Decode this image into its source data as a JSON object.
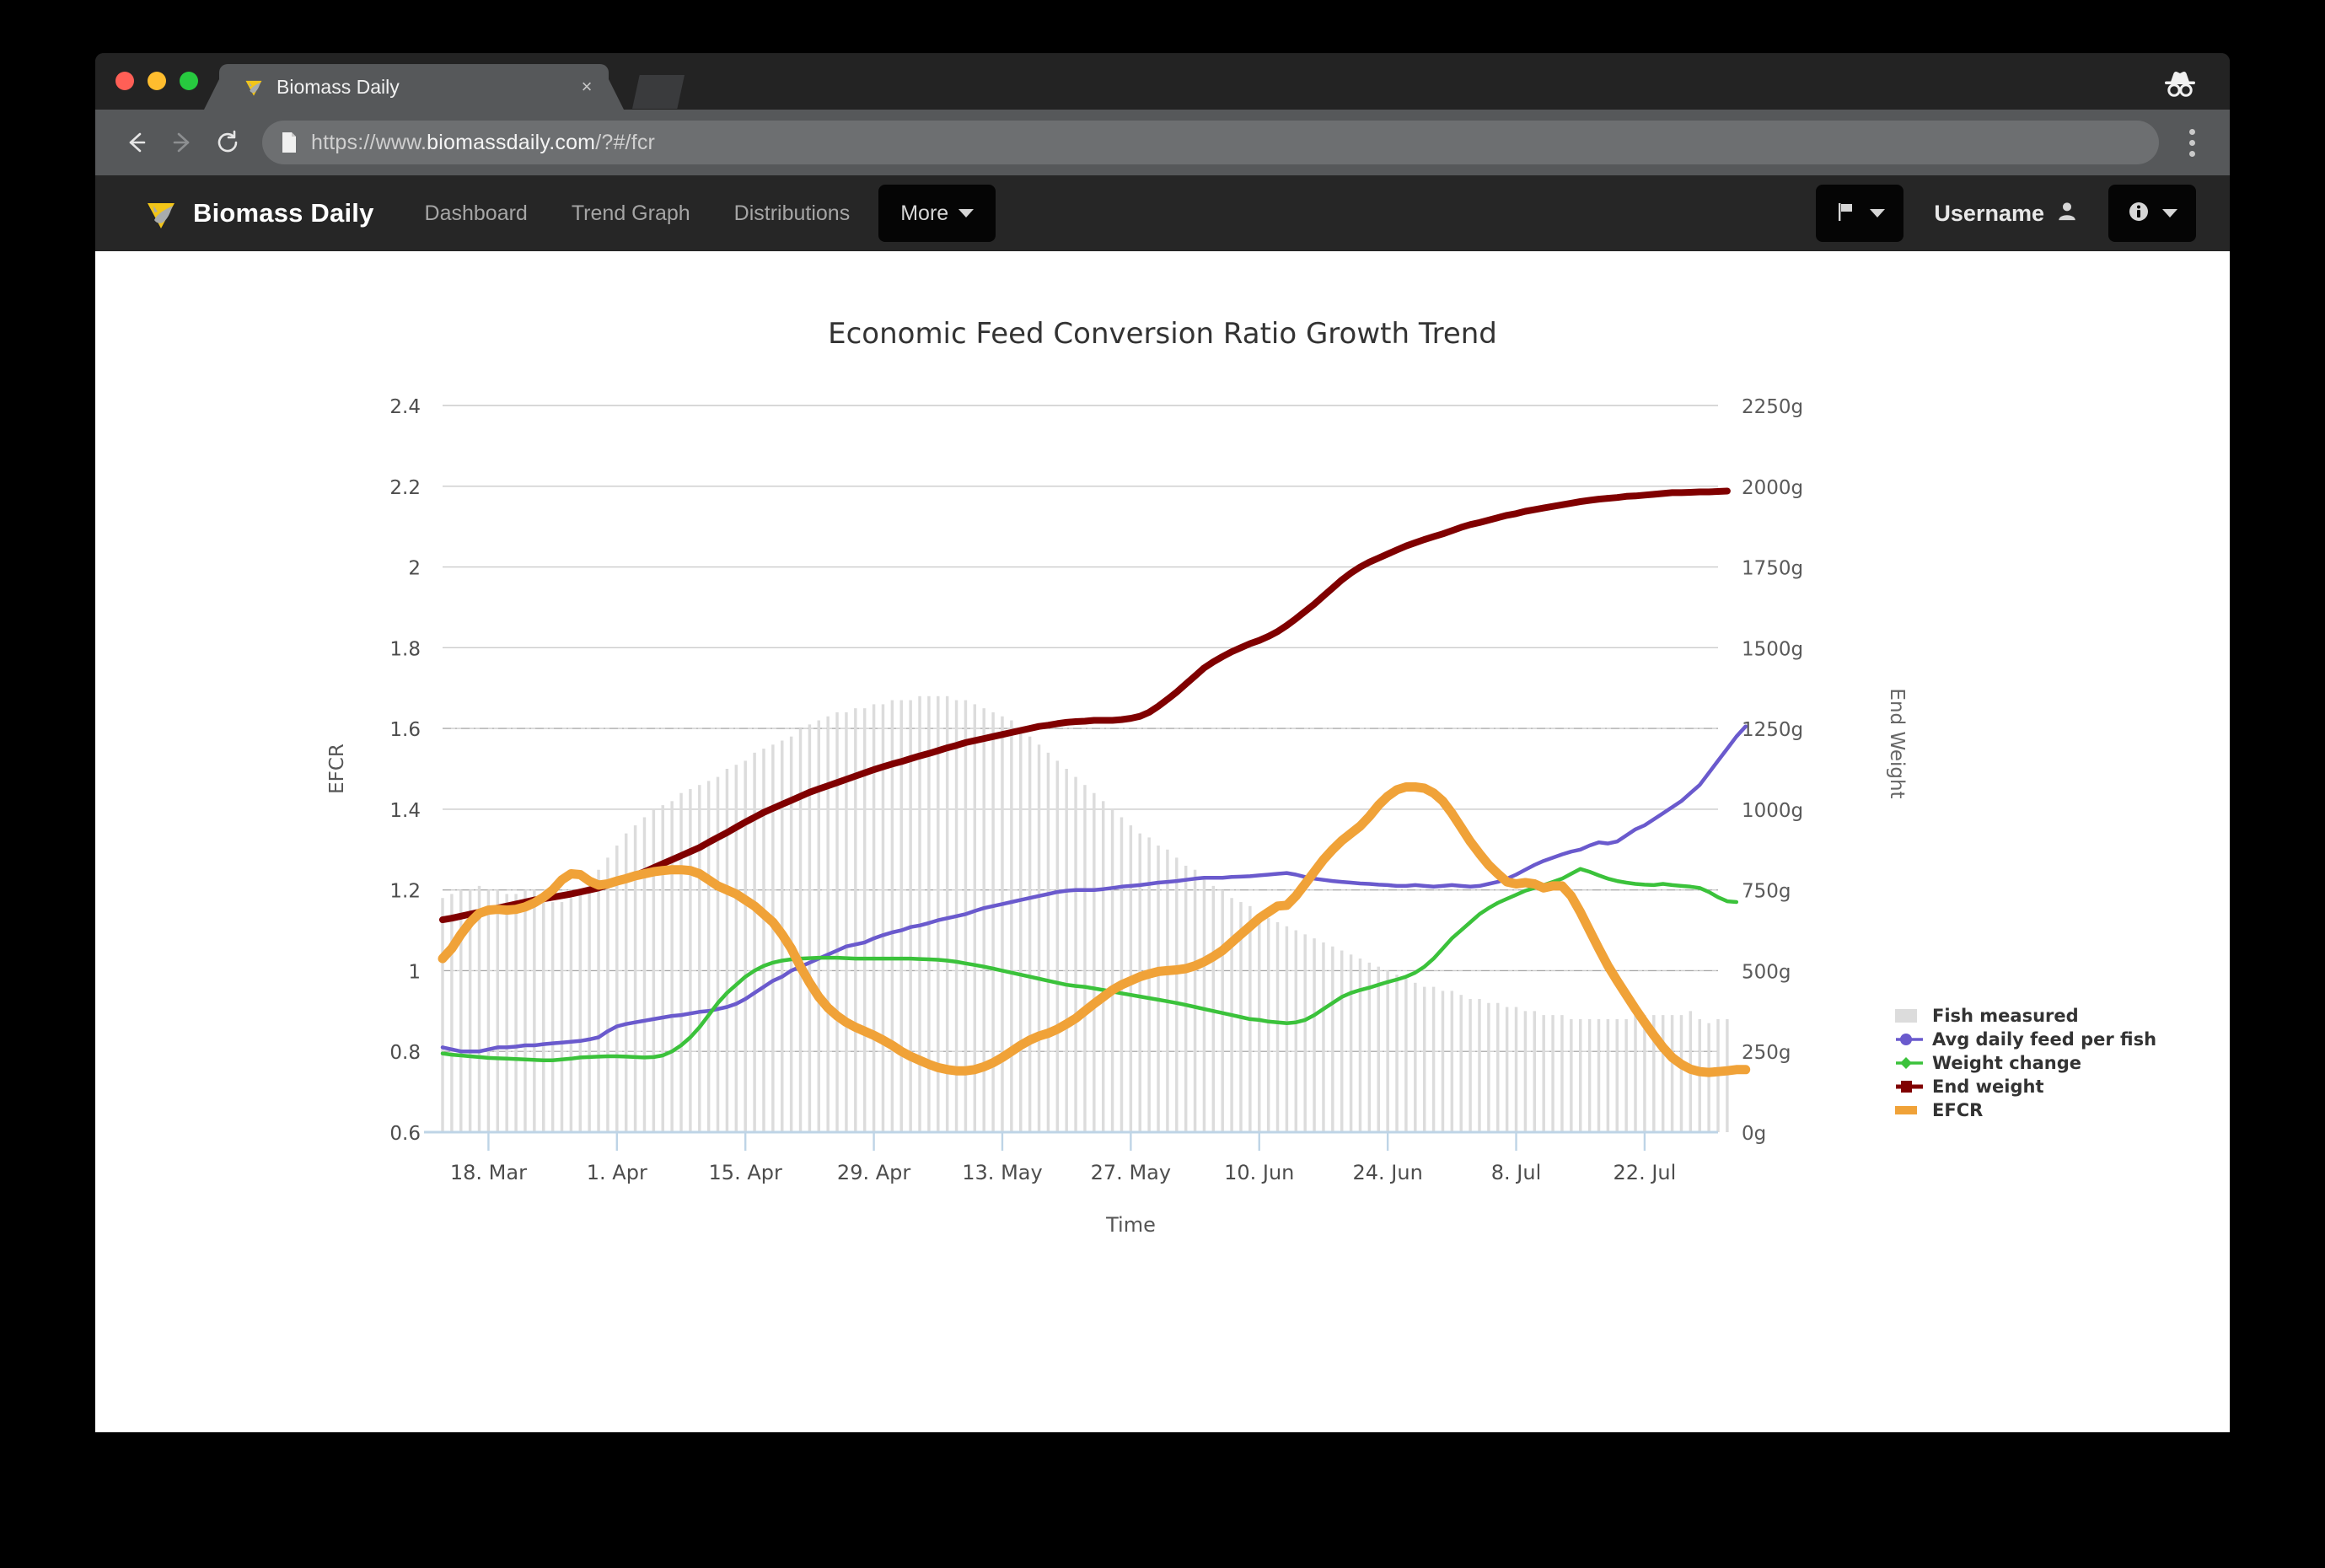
{
  "browser": {
    "tab": {
      "title": "Biomass Daily",
      "close_label": "×",
      "favicon": "fish-triangle-icon"
    },
    "new_tab_label": "new-tab",
    "incognito_label": "incognito-icon",
    "toolbar": {
      "back": "back-arrow-icon",
      "forward": "forward-arrow-icon",
      "reload": "reload-icon",
      "url_prefix": "https://www.",
      "url_host": "biomassdaily.com",
      "url_suffix": "/?#/fcr",
      "url_full": "https://www.biomassdaily.com/?#/fcr",
      "menu": "three-dots-icon"
    }
  },
  "navbar": {
    "brand": "Biomass Daily",
    "links": [
      {
        "label": "Dashboard"
      },
      {
        "label": "Trend Graph"
      },
      {
        "label": "Distributions"
      }
    ],
    "more_label": "More",
    "flag_icon": "flag-icon",
    "username": "Username",
    "user_icon": "person-icon",
    "info_icon": "info-circle-icon"
  },
  "colors": {
    "fish_measured": "#dcdcdc",
    "avg_daily_feed": "#6a5acd",
    "weight_change": "#3bc23b",
    "end_weight": "#800000",
    "efcr": "#f0a238",
    "axis": "#c5d8e8",
    "grid": "#cccccc",
    "navbar_bg": "#262626",
    "brand_yellow": "#f2c518"
  },
  "chart_data": {
    "type": "line",
    "title": "Economic Feed Conversion Ratio Growth Trend",
    "xlabel": "Time",
    "ylabel": "EFCR",
    "y2label": "End Weight",
    "grid": true,
    "legend_position": "right",
    "ylim": [
      0.6,
      2.4
    ],
    "yticks": [
      "0.6",
      "0.8",
      "1",
      "1.2",
      "1.4",
      "1.6",
      "1.8",
      "2",
      "2.2",
      "2.4"
    ],
    "y2lim": [
      0,
      2250
    ],
    "y2ticks": [
      "0g",
      "250g",
      "500g",
      "750g",
      "1000g",
      "1250g",
      "1500g",
      "1750g",
      "2000g",
      "2250g"
    ],
    "xticks": [
      "18. Mar",
      "1. Apr",
      "15. Apr",
      "29. Apr",
      "13. May",
      "27. May",
      "10. Jun",
      "24. Jun",
      "8. Jul",
      "22. Jul"
    ],
    "xtick_positions": [
      5,
      19,
      33,
      47,
      61,
      75,
      89,
      103,
      117,
      131
    ],
    "n_points": 140,
    "series": [
      {
        "name": "Fish measured",
        "type": "bar",
        "axis": "left",
        "color": "#dcdcdc",
        "values": [
          1.18,
          1.19,
          1.2,
          1.2,
          1.21,
          1.2,
          1.2,
          1.19,
          1.19,
          1.2,
          1.2,
          1.19,
          1.17,
          1.17,
          1.18,
          1.2,
          1.22,
          1.25,
          1.28,
          1.31,
          1.34,
          1.36,
          1.38,
          1.4,
          1.41,
          1.42,
          1.44,
          1.45,
          1.46,
          1.47,
          1.48,
          1.5,
          1.51,
          1.52,
          1.54,
          1.55,
          1.56,
          1.57,
          1.58,
          1.6,
          1.61,
          1.62,
          1.63,
          1.64,
          1.64,
          1.65,
          1.65,
          1.66,
          1.66,
          1.67,
          1.67,
          1.67,
          1.68,
          1.68,
          1.68,
          1.68,
          1.67,
          1.67,
          1.66,
          1.65,
          1.64,
          1.63,
          1.62,
          1.6,
          1.58,
          1.56,
          1.54,
          1.52,
          1.5,
          1.48,
          1.46,
          1.44,
          1.42,
          1.4,
          1.38,
          1.36,
          1.34,
          1.33,
          1.31,
          1.3,
          1.28,
          1.26,
          1.25,
          1.23,
          1.21,
          1.2,
          1.18,
          1.17,
          1.16,
          1.14,
          1.13,
          1.12,
          1.11,
          1.1,
          1.09,
          1.08,
          1.07,
          1.06,
          1.05,
          1.04,
          1.03,
          1.02,
          1.01,
          1,
          0.99,
          0.98,
          0.97,
          0.96,
          0.96,
          0.95,
          0.95,
          0.94,
          0.93,
          0.93,
          0.92,
          0.92,
          0.91,
          0.91,
          0.9,
          0.9,
          0.89,
          0.89,
          0.89,
          0.88,
          0.88,
          0.88,
          0.88,
          0.88,
          0.88,
          0.88,
          0.89,
          0.89,
          0.89,
          0.89,
          0.89,
          0.89,
          0.9,
          0.88,
          0.87,
          0.88,
          0.88
        ]
      },
      {
        "name": "Avg daily feed per fish",
        "type": "line",
        "axis": "left",
        "color": "#6a5acd",
        "values": [
          0.81,
          0.805,
          0.8,
          0.8,
          0.8,
          0.805,
          0.81,
          0.81,
          0.812,
          0.815,
          0.815,
          0.818,
          0.82,
          0.822,
          0.824,
          0.826,
          0.83,
          0.835,
          0.85,
          0.862,
          0.868,
          0.872,
          0.876,
          0.88,
          0.884,
          0.888,
          0.89,
          0.894,
          0.898,
          0.9,
          0.905,
          0.91,
          0.918,
          0.93,
          0.945,
          0.96,
          0.975,
          0.985,
          1,
          1.01,
          1.02,
          1.03,
          1.04,
          1.05,
          1.06,
          1.065,
          1.07,
          1.08,
          1.088,
          1.095,
          1.1,
          1.108,
          1.112,
          1.118,
          1.125,
          1.13,
          1.135,
          1.14,
          1.148,
          1.155,
          1.16,
          1.165,
          1.17,
          1.175,
          1.18,
          1.185,
          1.19,
          1.195,
          1.198,
          1.2,
          1.2,
          1.2,
          1.202,
          1.205,
          1.208,
          1.21,
          1.212,
          1.215,
          1.218,
          1.22,
          1.222,
          1.225,
          1.228,
          1.23,
          1.23,
          1.23,
          1.232,
          1.233,
          1.234,
          1.236,
          1.238,
          1.24,
          1.242,
          1.238,
          1.232,
          1.228,
          1.225,
          1.222,
          1.22,
          1.218,
          1.216,
          1.215,
          1.213,
          1.212,
          1.21,
          1.21,
          1.212,
          1.21,
          1.208,
          1.21,
          1.212,
          1.21,
          1.208,
          1.21,
          1.215,
          1.22,
          1.228,
          1.238,
          1.25,
          1.262,
          1.272,
          1.28,
          1.288,
          1.295,
          1.3,
          1.31,
          1.318,
          1.315,
          1.32,
          1.335,
          1.35,
          1.36,
          1.375,
          1.39,
          1.405,
          1.42,
          1.44,
          1.46,
          1.49,
          1.52,
          1.55,
          1.58,
          1.605
        ]
      },
      {
        "name": "Weight change",
        "type": "line",
        "axis": "left",
        "color": "#3bc23b",
        "values": [
          0.795,
          0.792,
          0.79,
          0.788,
          0.786,
          0.784,
          0.783,
          0.782,
          0.781,
          0.78,
          0.779,
          0.778,
          0.778,
          0.78,
          0.782,
          0.785,
          0.786,
          0.787,
          0.788,
          0.788,
          0.787,
          0.786,
          0.785,
          0.786,
          0.79,
          0.8,
          0.815,
          0.835,
          0.86,
          0.89,
          0.92,
          0.945,
          0.965,
          0.985,
          1,
          1.012,
          1.02,
          1.025,
          1.028,
          1.03,
          1.031,
          1.032,
          1.032,
          1.032,
          1.031,
          1.03,
          1.03,
          1.03,
          1.03,
          1.03,
          1.03,
          1.03,
          1.029,
          1.028,
          1.027,
          1.025,
          1.022,
          1.018,
          1.014,
          1.01,
          1.005,
          1,
          0.995,
          0.99,
          0.985,
          0.98,
          0.975,
          0.97,
          0.965,
          0.962,
          0.96,
          0.956,
          0.952,
          0.948,
          0.944,
          0.94,
          0.936,
          0.932,
          0.928,
          0.924,
          0.92,
          0.915,
          0.91,
          0.905,
          0.9,
          0.895,
          0.89,
          0.885,
          0.88,
          0.878,
          0.874,
          0.872,
          0.87,
          0.872,
          0.878,
          0.89,
          0.905,
          0.92,
          0.935,
          0.945,
          0.952,
          0.958,
          0.965,
          0.972,
          0.978,
          0.985,
          0.995,
          1.01,
          1.03,
          1.055,
          1.08,
          1.1,
          1.12,
          1.14,
          1.155,
          1.168,
          1.178,
          1.188,
          1.198,
          1.205,
          1.212,
          1.22,
          1.228,
          1.24,
          1.252,
          1.245,
          1.236,
          1.228,
          1.222,
          1.218,
          1.215,
          1.213,
          1.212,
          1.215,
          1.212,
          1.21,
          1.208,
          1.205,
          1.195,
          1.182,
          1.172,
          1.17
        ]
      },
      {
        "name": "End weight",
        "type": "line",
        "axis": "right",
        "color": "#800000",
        "values": [
          1.126,
          1.13,
          1.135,
          1.14,
          1.145,
          1.15,
          1.155,
          1.16,
          1.165,
          1.17,
          1.175,
          1.178,
          1.182,
          1.186,
          1.19,
          1.195,
          1.2,
          1.205,
          1.212,
          1.22,
          1.228,
          1.236,
          1.245,
          1.255,
          1.265,
          1.275,
          1.285,
          1.295,
          1.305,
          1.318,
          1.33,
          1.342,
          1.355,
          1.368,
          1.38,
          1.392,
          1.402,
          1.412,
          1.422,
          1.432,
          1.442,
          1.45,
          1.458,
          1.466,
          1.474,
          1.482,
          1.49,
          1.498,
          1.505,
          1.512,
          1.518,
          1.525,
          1.532,
          1.538,
          1.545,
          1.552,
          1.558,
          1.565,
          1.57,
          1.575,
          1.58,
          1.585,
          1.59,
          1.595,
          1.6,
          1.605,
          1.608,
          1.612,
          1.615,
          1.617,
          1.618,
          1.62,
          1.62,
          1.62,
          1.622,
          1.625,
          1.63,
          1.64,
          1.655,
          1.672,
          1.69,
          1.71,
          1.73,
          1.75,
          1.765,
          1.778,
          1.79,
          1.8,
          1.81,
          1.818,
          1.828,
          1.84,
          1.855,
          1.872,
          1.89,
          1.908,
          1.928,
          1.948,
          1.968,
          1.985,
          2,
          2.012,
          2.022,
          2.032,
          2.042,
          2.052,
          2.06,
          2.068,
          2.075,
          2.082,
          2.09,
          2.098,
          2.105,
          2.11,
          2.116,
          2.122,
          2.128,
          2.132,
          2.138,
          2.142,
          2.146,
          2.15,
          2.154,
          2.158,
          2.162,
          2.165,
          2.168,
          2.17,
          2.172,
          2.175,
          2.176,
          2.178,
          2.18,
          2.182,
          2.184,
          2.184,
          2.185,
          2.186,
          2.186,
          2.187,
          2.188
        ]
      },
      {
        "name": "EFCR",
        "type": "line",
        "axis": "left",
        "color": "#f0a238",
        "values": [
          1.03,
          1.055,
          1.09,
          1.12,
          1.142,
          1.15,
          1.152,
          1.15,
          1.152,
          1.158,
          1.168,
          1.182,
          1.2,
          1.225,
          1.24,
          1.238,
          1.222,
          1.212,
          1.215,
          1.222,
          1.228,
          1.235,
          1.24,
          1.245,
          1.248,
          1.25,
          1.25,
          1.248,
          1.24,
          1.225,
          1.21,
          1.2,
          1.19,
          1.175,
          1.16,
          1.14,
          1.12,
          1.09,
          1.055,
          1.01,
          0.97,
          0.935,
          0.908,
          0.888,
          0.872,
          0.86,
          0.85,
          0.84,
          0.828,
          0.815,
          0.8,
          0.788,
          0.778,
          0.768,
          0.76,
          0.755,
          0.752,
          0.752,
          0.755,
          0.762,
          0.772,
          0.785,
          0.8,
          0.815,
          0.828,
          0.838,
          0.845,
          0.855,
          0.868,
          0.882,
          0.9,
          0.918,
          0.935,
          0.952,
          0.965,
          0.975,
          0.985,
          0.992,
          0.998,
          1,
          1.002,
          1.005,
          1.012,
          1.022,
          1.035,
          1.05,
          1.07,
          1.09,
          1.11,
          1.13,
          1.145,
          1.16,
          1.162,
          1.185,
          1.215,
          1.245,
          1.275,
          1.3,
          1.322,
          1.34,
          1.358,
          1.382,
          1.41,
          1.432,
          1.448,
          1.455,
          1.455,
          1.452,
          1.44,
          1.42,
          1.39,
          1.355,
          1.32,
          1.29,
          1.262,
          1.24,
          1.22,
          1.215,
          1.218,
          1.215,
          1.205,
          1.21,
          1.21,
          1.185,
          1.145,
          1.1,
          1.055,
          1.012,
          0.975,
          0.94,
          0.905,
          0.872,
          0.84,
          0.81,
          0.785,
          0.768,
          0.756,
          0.75,
          0.748,
          0.75,
          0.752,
          0.755,
          0.755
        ]
      }
    ]
  }
}
